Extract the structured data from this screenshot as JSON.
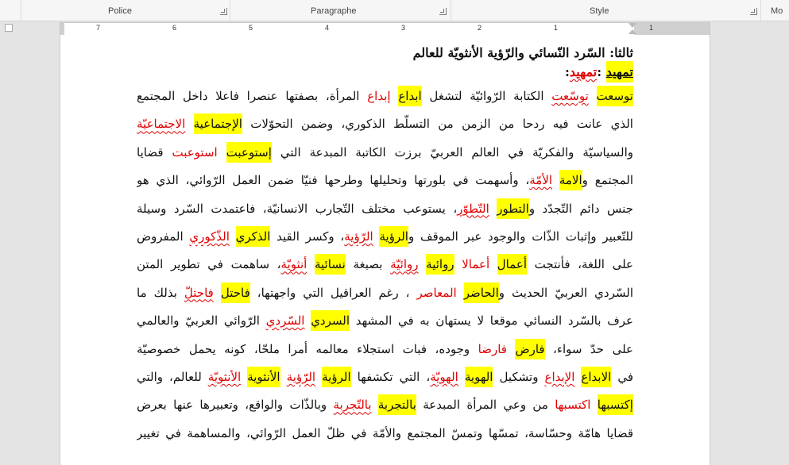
{
  "ribbon": {
    "groups": [
      {
        "label": "Police"
      },
      {
        "label": "Paragraphe"
      },
      {
        "label": "Style"
      },
      {
        "label": "Mo"
      }
    ]
  },
  "ruler": {
    "numbers": [
      "7",
      "6",
      "5",
      "4",
      "3",
      "2",
      "1",
      "1"
    ]
  },
  "document": {
    "heading": "ثالثا: السّرد النّسائي والرّؤية الأنثويّة للعالم",
    "subheading_prefix": "تمهيد",
    "subheading_sep": " :",
    "subheading_red": "تمهيد",
    "subheading_colon": ":",
    "lines": [
      [
        {
          "t": "توسعت",
          "s": "hl"
        },
        {
          "t": " "
        },
        {
          "t": "توسّعت",
          "s": "red"
        },
        {
          "t": " الكتابة الرّوائيّة لتشغل "
        },
        {
          "t": "ابداع",
          "s": "hl"
        },
        {
          "t": " "
        },
        {
          "t": "إبداع",
          "s": "red-plain"
        },
        {
          "t": " المرأة، بصفتها عنصرا فاعلا داخل المجتمع"
        }
      ],
      [
        {
          "t": "الذي عانت فيه ردحا من الزمن من التسلّط الذكوري، وضمن التحوّلات "
        },
        {
          "t": "الإجتماعية",
          "s": "hl"
        },
        {
          "t": " "
        },
        {
          "t": "الاجتماعيّة",
          "s": "red"
        }
      ],
      [
        {
          "t": "والسياسيّة والفكريّة في العالم العربيّ برزت الكاتبة المبدعة التي "
        },
        {
          "t": "إستوعبت",
          "s": "hl"
        },
        {
          "t": " "
        },
        {
          "t": "استوعبت",
          "s": "red-plain"
        },
        {
          "t": " قضايا"
        }
      ],
      [
        {
          "t": "المجتمع و"
        },
        {
          "t": "الامة",
          "s": "hl"
        },
        {
          "t": " "
        },
        {
          "t": "الأمّة",
          "s": "red"
        },
        {
          "t": "، وأسهمت في بلورتها وتحليلها وطرحها فنيّا ضمن العمل الرّوائي، الذي هو"
        }
      ],
      [
        {
          "t": "جنس دائم التّجدّد و"
        },
        {
          "t": "التطور",
          "s": "hl"
        },
        {
          "t": " "
        },
        {
          "t": "التّطوّر",
          "s": "red"
        },
        {
          "t": "، يستوعب مختلف التّجارب الانسانيّة، فاعتمدت السّرد وسيلة"
        }
      ],
      [
        {
          "t": "للتّعبير وإثبات الذّات والوجود عبر الموقف و"
        },
        {
          "t": "الرؤية",
          "s": "hl"
        },
        {
          "t": " "
        },
        {
          "t": "الرّؤية",
          "s": "red"
        },
        {
          "t": "، وكسر القيد "
        },
        {
          "t": "الذكري",
          "s": "hl"
        },
        {
          "t": " "
        },
        {
          "t": "الذّكوري",
          "s": "red"
        },
        {
          "t": " المفروض"
        }
      ],
      [
        {
          "t": "على اللغة، فأنتجت "
        },
        {
          "t": "أعمال",
          "s": "hl"
        },
        {
          "t": " "
        },
        {
          "t": "أعمالا",
          "s": "red-plain"
        },
        {
          "t": " "
        },
        {
          "t": "روائية",
          "s": "hl"
        },
        {
          "t": " "
        },
        {
          "t": "روائيّة",
          "s": "red"
        },
        {
          "t": " بصبغة "
        },
        {
          "t": "نسائية",
          "s": "hl"
        },
        {
          "t": " "
        },
        {
          "t": "أنثويّة",
          "s": "red"
        },
        {
          "t": "، ساهمت في تطوير المتن"
        }
      ],
      [
        {
          "t": "السّردي العربيّ الحديث و"
        },
        {
          "t": "الحاضر",
          "s": "hl"
        },
        {
          "t": " "
        },
        {
          "t": "المعاصر",
          "s": "red-plain"
        },
        {
          "t": " ، رغم العراقيل التي واجهتها، "
        },
        {
          "t": "فاحتل",
          "s": "hl"
        },
        {
          "t": " "
        },
        {
          "t": "فاحتلّ",
          "s": "red"
        },
        {
          "t": " بذلك ما"
        }
      ],
      [
        {
          "t": "عرف بالسّرد النسائي موقعا لا يستهان به في المشهد "
        },
        {
          "t": "السردي",
          "s": "hl"
        },
        {
          "t": " "
        },
        {
          "t": "السّردي",
          "s": "red"
        },
        {
          "t": " الرّوائي العربيّ والعالمي"
        }
      ],
      [
        {
          "t": "على حدّ سواء، "
        },
        {
          "t": "فارض",
          "s": "hl"
        },
        {
          "t": " "
        },
        {
          "t": "فارضا",
          "s": "red-plain"
        },
        {
          "t": " وجوده، فبات استجلاء معالمه أمرا ملحّا، كونه يحمل خصوصيّة"
        }
      ],
      [
        {
          "t": "في "
        },
        {
          "t": "الابداع",
          "s": "hl"
        },
        {
          "t": " "
        },
        {
          "t": "الإبداع",
          "s": "red"
        },
        {
          "t": " وتشكيل "
        },
        {
          "t": "الهوية",
          "s": "hl"
        },
        {
          "t": " "
        },
        {
          "t": "الهويّة",
          "s": "red"
        },
        {
          "t": "، التي تكشفها "
        },
        {
          "t": "الرؤية",
          "s": "hl"
        },
        {
          "t": " "
        },
        {
          "t": "الرّؤية",
          "s": "red"
        },
        {
          "t": " "
        },
        {
          "t": "الأنثوية",
          "s": "hl"
        },
        {
          "t": " "
        },
        {
          "t": "الأنثويّة",
          "s": "red"
        },
        {
          "t": " للعالم، والتي"
        }
      ],
      [
        {
          "t": "إكتسبها",
          "s": "hl"
        },
        {
          "t": " "
        },
        {
          "t": "اكتسبها",
          "s": "red-plain"
        },
        {
          "t": " من وعي المرأة المبدعة "
        },
        {
          "t": "بالتجربة",
          "s": "hl"
        },
        {
          "t": " "
        },
        {
          "t": "بالتّجربة",
          "s": "red"
        },
        {
          "t": " وبالذّات والواقع، وتعبيرها عنها بعرض"
        }
      ],
      [
        {
          "t": "قضايا هامّة وحسّاسة، تمسّها وتمسّ المجتمع والأمّة في ظلّ العمل الرّوائي، والمساهمة في تغيير"
        }
      ]
    ]
  },
  "colors": {
    "highlight": "#ffff00",
    "correction": "#e00000"
  }
}
